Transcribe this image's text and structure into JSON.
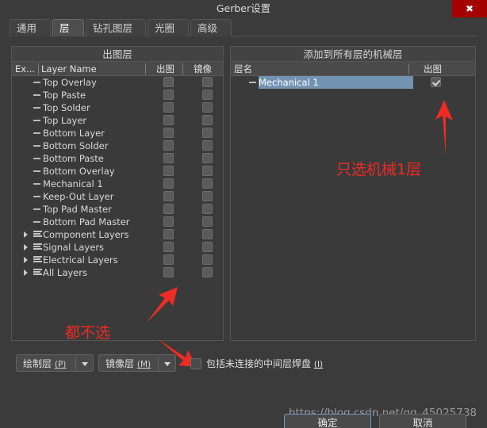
{
  "window": {
    "title": "Gerber设置",
    "close_icon": "close-icon"
  },
  "tabs": [
    {
      "label": "通用",
      "active": false
    },
    {
      "label": "层",
      "active": true
    },
    {
      "label": "钻孔图层",
      "active": false
    },
    {
      "label": "光圈",
      "active": false
    },
    {
      "label": "高级",
      "active": false
    }
  ],
  "plot_layers_panel": {
    "title": "出图层",
    "columns": [
      "Ex...",
      "Layer Name",
      "出图",
      "镜像"
    ],
    "rows": [
      {
        "name": "Top Overlay",
        "kind": "leaf",
        "plot": false,
        "mirror": false
      },
      {
        "name": "Top Paste",
        "kind": "leaf",
        "plot": false,
        "mirror": false
      },
      {
        "name": "Top Solder",
        "kind": "leaf",
        "plot": false,
        "mirror": false
      },
      {
        "name": "Top Layer",
        "kind": "leaf",
        "plot": false,
        "mirror": false
      },
      {
        "name": "Bottom Layer",
        "kind": "leaf",
        "plot": false,
        "mirror": false
      },
      {
        "name": "Bottom Solder",
        "kind": "leaf",
        "plot": false,
        "mirror": false
      },
      {
        "name": "Bottom Paste",
        "kind": "leaf",
        "plot": false,
        "mirror": false
      },
      {
        "name": "Bottom Overlay",
        "kind": "leaf",
        "plot": false,
        "mirror": false
      },
      {
        "name": "Mechanical 1",
        "kind": "leaf",
        "plot": false,
        "mirror": false
      },
      {
        "name": "Keep-Out Layer",
        "kind": "leaf",
        "plot": false,
        "mirror": false
      },
      {
        "name": "Top Pad Master",
        "kind": "leaf",
        "plot": false,
        "mirror": false
      },
      {
        "name": "Bottom Pad Master",
        "kind": "leaf",
        "plot": false,
        "mirror": false
      },
      {
        "name": "Component Layers",
        "kind": "group",
        "plot": false,
        "mirror": false
      },
      {
        "name": "Signal Layers",
        "kind": "group",
        "plot": false,
        "mirror": false
      },
      {
        "name": "Electrical Layers",
        "kind": "group",
        "plot": false,
        "mirror": false
      },
      {
        "name": "All Layers",
        "kind": "group",
        "plot": false,
        "mirror": false
      }
    ]
  },
  "mechanical_panel": {
    "title": "添加到所有层的机械层",
    "columns": [
      "层名",
      "出图"
    ],
    "rows": [
      {
        "name": "Mechanical 1",
        "kind": "leaf",
        "selected": true,
        "plot": true
      }
    ]
  },
  "bottom_bar": {
    "plot_layers_button": {
      "label": "绘制层",
      "accel": "(P)"
    },
    "mirror_layers_button": {
      "label": "镜像层",
      "accel": "(M)"
    },
    "include_unconnected": {
      "label": "包括未连接的中间层焊盘",
      "accel": "(I)",
      "checked": false
    }
  },
  "annotations": [
    {
      "text": "只选机械1层",
      "color": "#ee2b25"
    },
    {
      "text": "都不选",
      "color": "#ee2b25"
    }
  ],
  "watermark": "https://blog.csdn.net/qq_45025738",
  "footer": {
    "ok_label": "确定",
    "cancel_label": "取消"
  },
  "colors": {
    "dialog_bg": "#3b3b3b",
    "accent_red": "#ee2b25",
    "close_red": "#a50000",
    "selection_blue": "#7393b3"
  }
}
